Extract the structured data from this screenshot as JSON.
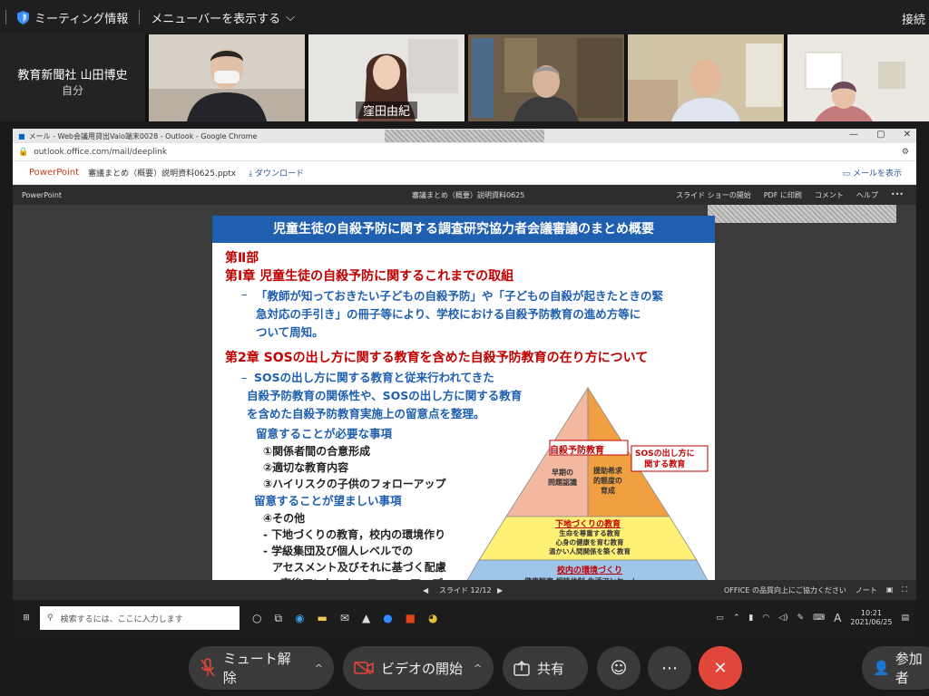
{
  "topbar": {
    "meeting_info": "ミーティング情報",
    "menu_toggle": "メニューバーを表示する",
    "connection": "接続"
  },
  "self": {
    "name": "教育新聞社 山田博史",
    "sub": "自分"
  },
  "participants": [
    {
      "name": ""
    },
    {
      "name": "窪田由紀"
    },
    {
      "name": ""
    },
    {
      "name": ""
    },
    {
      "name": ""
    }
  ],
  "browser": {
    "tab_title": "メール - Web会議用貸出Vaio端末0028 - Outlook - Google Chrome",
    "url": "outlook.office.com/mail/deeplink"
  },
  "ppt": {
    "brand": "PowerPoint",
    "file": "審議まとめ（概要）説明資料0625.pptx",
    "download": "ダウンロード",
    "show_mail": "メールを表示",
    "viewer_label": "PowerPoint",
    "viewer_title": "審議まとめ（概要）説明資料0625",
    "tools": [
      "スライド ショーの開始",
      "PDF に印刷",
      "コメント",
      "ヘルプ"
    ],
    "slide_counter": "スライド 12/12",
    "feedback": "OFFICE の品質向上にご協力ください",
    "notes": "ノート"
  },
  "slide": {
    "title": "児童生徒の自殺予防に関する調査研究協力者会議審議のまとめ概要",
    "part": "第Ⅱ部",
    "ch1": "第Ⅰ章 児童生徒の自殺予防に関するこれまでの取組",
    "ch1_text": [
      "「教師が知っておきたい子どもの自殺予防」や「子どもの自殺が起きたときの緊",
      "急対応の手引き」の冊子等により、学校における自殺予防教育の進め方等に",
      "ついて周知。"
    ],
    "ch2": "第2章 SOSの出し方に関する教育を含めた自殺予防教育の在り方について",
    "ch2_text": [
      "SOSの出し方に関する教育と従来行われてきた",
      "自殺予防教育の関係性や、SOSの出し方に関する教育",
      "を含めた自殺予防教育実施上の留意点を整理。"
    ],
    "need_title": "留意することが必要な事項",
    "need_items": [
      "①関係者間の合意形成",
      "②適切な教育内容",
      "③ハイリスクの子供のフォローアップ"
    ],
    "want_title": "留意することが望ましい事項",
    "want_items": [
      "④その他",
      "- 下地づくりの教育，校内の環境作り",
      "- 学級集団及び個人レベルでの",
      "アセスメント及びそれに基づく配慮",
      "- 事後アンケート，フォローアップ"
    ],
    "pyramid": {
      "top_label": "自殺予防教育",
      "left_text": [
        "早期の",
        "問題認識"
      ],
      "right_text": [
        "援助希求",
        "的態度の",
        "育成"
      ],
      "callout": [
        "SOSの出し方に",
        "関する教育"
      ],
      "middle_label": "下地づくりの教育",
      "middle_text": [
        "生命を尊重する教育",
        "心身の健康を育む教育",
        "温かい人間関係を築く教育"
      ],
      "bottom_label": "校内の環境づくり",
      "bottom_text": "健康観察 相談体制 生活アンケート",
      "colors": {
        "top_left": "#f2b8a0",
        "top_right": "#f0a040",
        "middle": "#fff176",
        "bottom": "#9ec5ea"
      }
    }
  },
  "taskbar": {
    "search_placeholder": "検索するには、ここに入力します",
    "time": "10:21",
    "date": "2021/06/25",
    "ime": "A"
  },
  "controls": {
    "unmute": "ミュート解除",
    "start_video": "ビデオの開始",
    "share": "共有",
    "participants": "参加者"
  }
}
